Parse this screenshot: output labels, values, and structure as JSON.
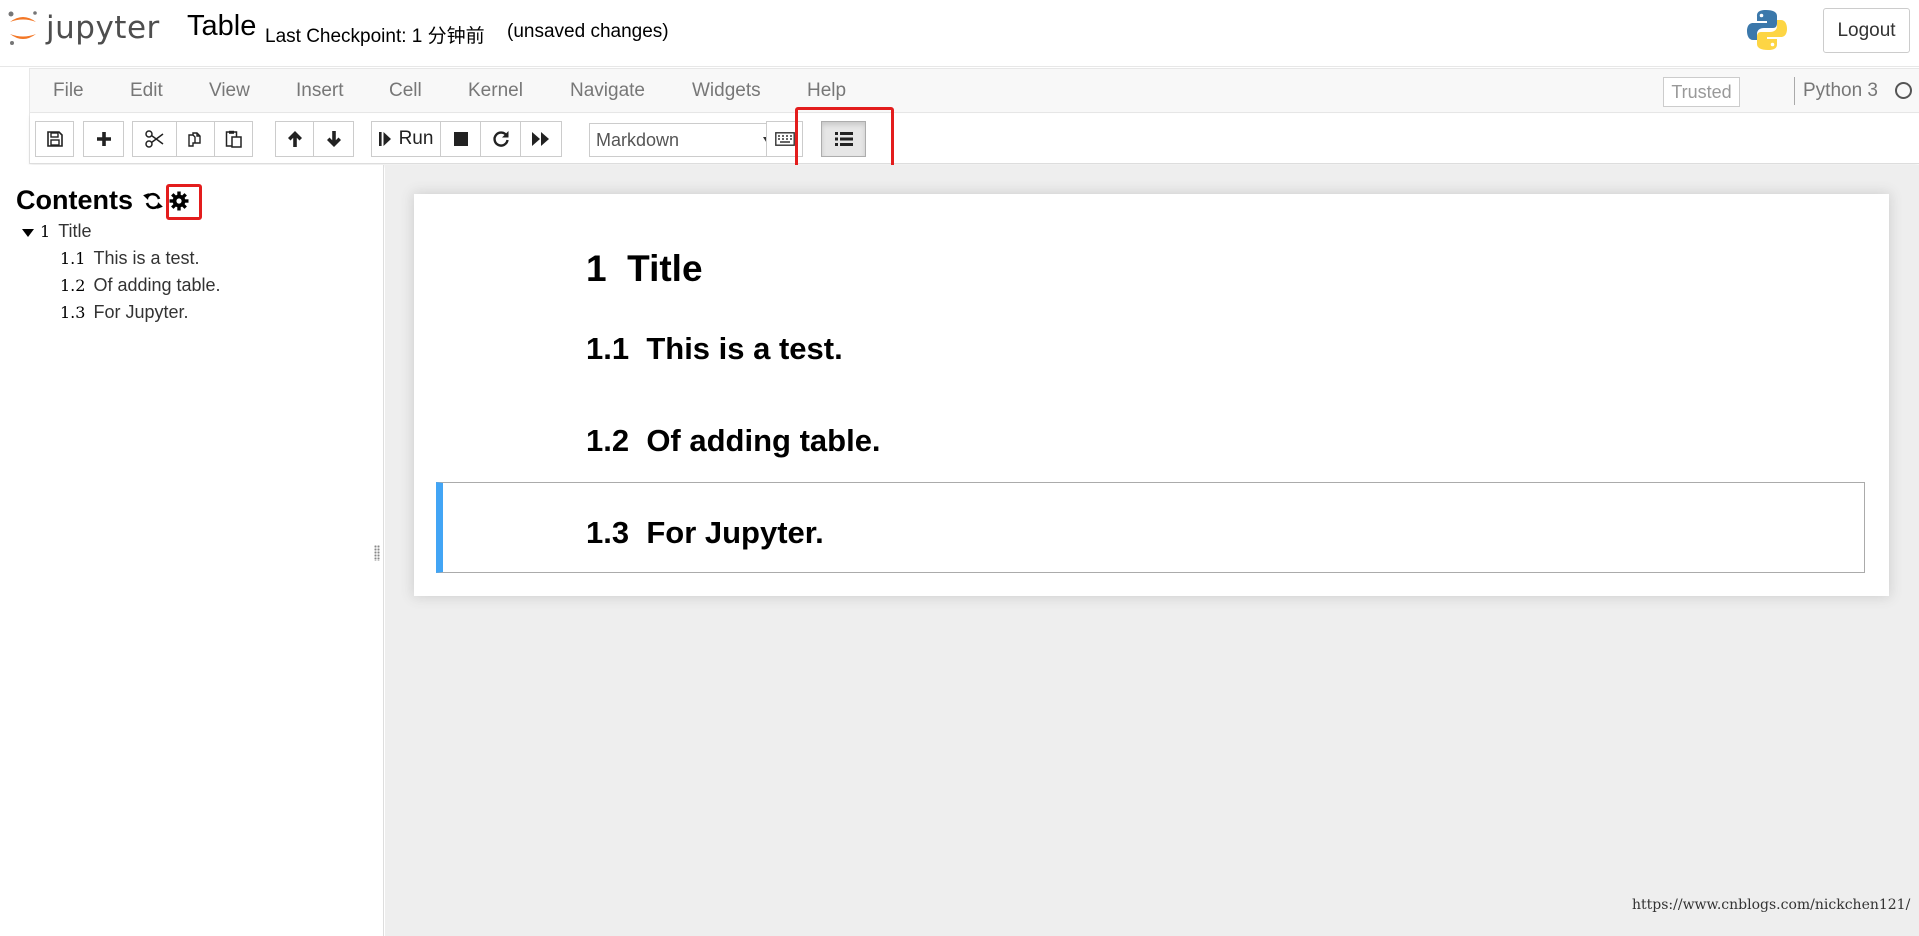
{
  "header": {
    "logo_text": "jupyter",
    "notebook_name": "Table",
    "checkpoint": "Last Checkpoint: 1 分钟前",
    "autosave_status": "(unsaved changes)",
    "logout_label": "Logout"
  },
  "menubar": {
    "items": [
      "File",
      "Edit",
      "View",
      "Insert",
      "Cell",
      "Kernel",
      "Navigate",
      "Widgets",
      "Help"
    ],
    "trusted_label": "Trusted",
    "kernel_name": "Python 3"
  },
  "toolbar": {
    "buttons": [
      "save-icon",
      "plus-icon",
      "cut-icon",
      "copy-icon",
      "paste-icon",
      "arrow-up-icon",
      "arrow-down-icon",
      "run-icon",
      "stop-icon",
      "restart-icon",
      "fast-forward-icon",
      "keyboard-icon",
      "list-icon"
    ],
    "run_label": "Run",
    "cell_type": "Markdown"
  },
  "toc": {
    "title": "Contents",
    "items": [
      {
        "number": "1",
        "label": "Title"
      },
      {
        "number": "1.1",
        "label": "This is a test."
      },
      {
        "number": "1.2",
        "label": "Of adding table."
      },
      {
        "number": "1.3",
        "label": "For Jupyter."
      }
    ]
  },
  "notebook": {
    "headings": [
      {
        "text": "1  Title"
      },
      {
        "text": "1.1  This is a test."
      },
      {
        "text": "1.2  Of adding table."
      },
      {
        "text": "1.3  For Jupyter."
      }
    ]
  },
  "watermark": "https://www.cnblogs.com/nickchen121/",
  "colors": {
    "highlight_box": "#e31d1d",
    "selected_cell_bar": "#42a5f5",
    "notebook_bg": "#eeeeee",
    "jupyter_orange": "#f37726"
  }
}
